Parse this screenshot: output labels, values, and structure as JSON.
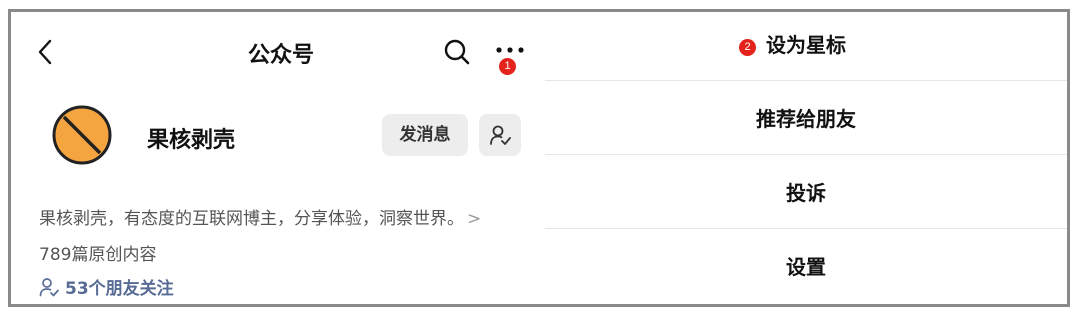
{
  "header": {
    "title": "公众号",
    "back_icon": "back-arrow-icon",
    "search_icon": "search-icon",
    "more_icon": "more-dots-icon"
  },
  "badges": {
    "step1": "1",
    "step2": "2",
    "color": "#e4231c"
  },
  "profile": {
    "name": "果核剥壳",
    "avatar_icon": "orange-circle-slash-logo",
    "avatar_color": "#f5a540",
    "message_button": "发消息",
    "follow_icon": "person-check-icon",
    "description": "果核剥壳，有态度的互联网博主，分享体验，洞察世界。",
    "description_chevron": ">",
    "article_count": "789篇原创内容",
    "friends_following": "53个朋友关注",
    "friends_color": "#576b95"
  },
  "menu": {
    "items": [
      {
        "label": "设为星标"
      },
      {
        "label": "推荐给朋友"
      },
      {
        "label": "投诉"
      },
      {
        "label": "设置"
      }
    ]
  }
}
